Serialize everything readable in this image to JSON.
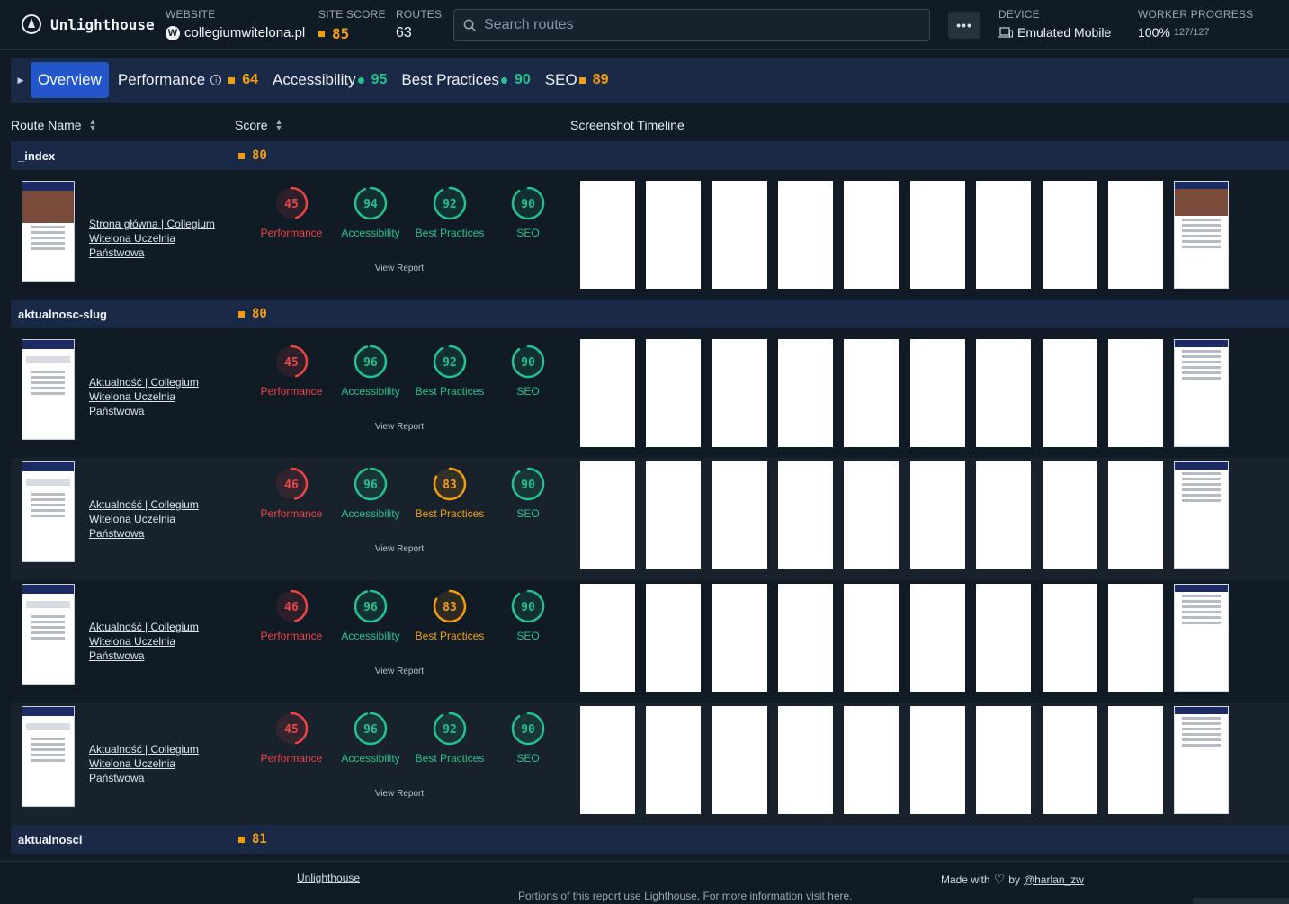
{
  "header": {
    "app_name": "Unlighthouse",
    "website_label": "WEBSITE",
    "website": "collegiumwitelona.pl",
    "site_score_label": "SITE SCORE",
    "site_score": "85",
    "routes_label": "ROUTES",
    "routes": "63",
    "search_placeholder": "Search routes",
    "more_label": "•••",
    "device_label": "DEVICE",
    "device": "Emulated Mobile",
    "worker_label": "WORKER PROGRESS",
    "worker_percent": "100%",
    "worker_count": "127/127"
  },
  "tabs": [
    {
      "label": "Overview",
      "score": ""
    },
    {
      "label": "Performance",
      "score": "64"
    },
    {
      "label": "Accessibility",
      "score": "95"
    },
    {
      "label": "Best Practices",
      "score": "90"
    },
    {
      "label": "SEO",
      "score": "89"
    }
  ],
  "columns": {
    "route_name": "Route Name",
    "score": "Score",
    "timeline": "Screenshot Timeline"
  },
  "groups": [
    {
      "name": "_index",
      "score": "80"
    },
    {
      "name": "aktualnosc-slug",
      "score": "80"
    },
    {
      "name": "aktualnosci",
      "score": "81"
    }
  ],
  "category_labels": [
    "Performance",
    "Accessibility",
    "Best Practices",
    "SEO"
  ],
  "view_report": "View Report",
  "routes": [
    {
      "title": "Strona główna | Collegium Witelona Uczelnia Państwowa",
      "scores": [
        45,
        94,
        92,
        90
      ]
    },
    {
      "title": "Aktualność | Collegium Witelona Uczelnia Państwowa",
      "scores": [
        45,
        96,
        92,
        90
      ]
    },
    {
      "title": "Aktualność | Collegium Witelona Uczelnia Państwowa",
      "scores": [
        46,
        96,
        83,
        90
      ]
    },
    {
      "title": "Aktualność | Collegium Witelona Uczelnia Państwowa",
      "scores": [
        46,
        96,
        83,
        90
      ]
    },
    {
      "title": "Aktualność | Collegium Witelona Uczelnia Państwowa",
      "scores": [
        45,
        96,
        92,
        90
      ]
    }
  ],
  "colors": {
    "good": "#22c38e",
    "average": "#f59e0b",
    "poor": "#ef4444",
    "accent": "#2357c9"
  },
  "footer": {
    "link": "Unlighthouse",
    "made_with": "Made with",
    "by": "by",
    "author": "@harlan_zw",
    "portions": "Portions of this report use Lighthouse. For more information visit here."
  }
}
